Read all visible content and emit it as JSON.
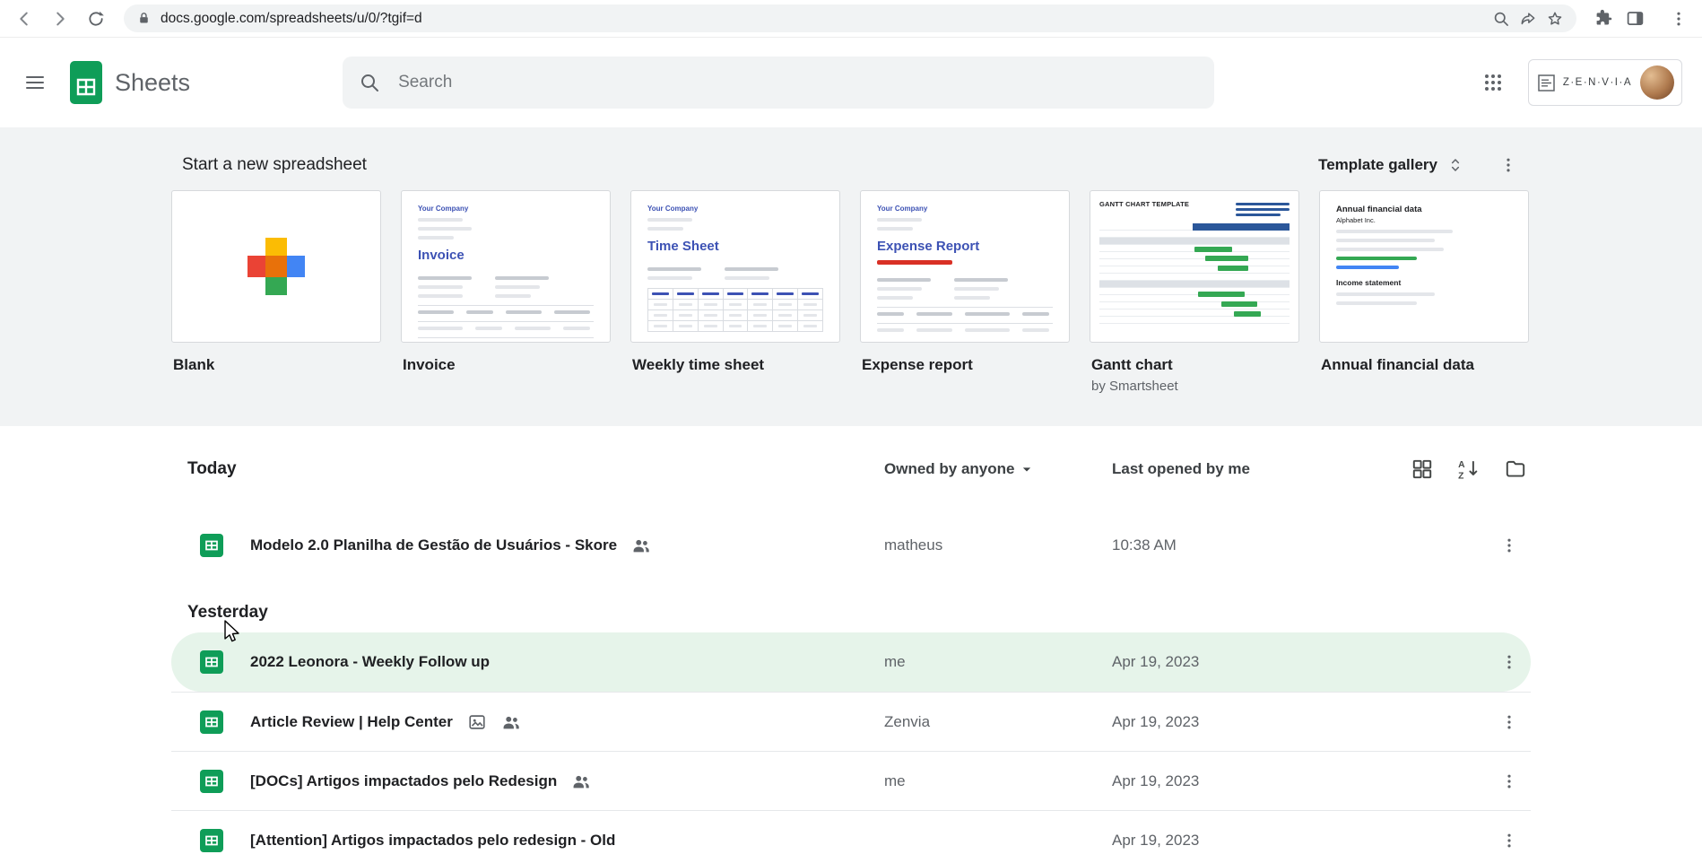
{
  "browser": {
    "url": "docs.google.com/spreadsheets/u/0/?tgif=d"
  },
  "header": {
    "app_name": "Sheets",
    "search_placeholder": "Search",
    "account_label": "Z·E·N·V·I·A"
  },
  "templates": {
    "title": "Start a new spreadsheet",
    "gallery_button": "Template gallery",
    "cards": [
      {
        "label": "Blank"
      },
      {
        "label": "Invoice",
        "thumb": {
          "company": "Your Company",
          "title": "Invoice"
        }
      },
      {
        "label": "Weekly time sheet",
        "thumb": {
          "company": "Your Company",
          "title": "Time Sheet"
        }
      },
      {
        "label": "Expense report",
        "thumb": {
          "company": "Your Company",
          "title": "Expense Report"
        }
      },
      {
        "label": "Gantt chart",
        "sublabel": "by Smartsheet",
        "thumb": {
          "title": "GANTT CHART TEMPLATE"
        }
      },
      {
        "label": "Annual financial data",
        "thumb": {
          "title": "Annual financial data",
          "subtitle": "Alphabet Inc.",
          "section": "Income statement"
        }
      }
    ]
  },
  "list": {
    "owner_filter": "Owned by anyone",
    "last_opened": "Last opened by me",
    "groups": [
      {
        "heading": "Today",
        "rows": [
          {
            "title": "Modelo 2.0 Planilha de Gestão de Usuários - Skore",
            "owner": "matheus",
            "opened": "10:38 AM"
          }
        ]
      },
      {
        "heading": "Yesterday",
        "rows": [
          {
            "title": "2022 Leonora - Weekly Follow up",
            "owner": "me",
            "opened": "Apr 19, 2023"
          },
          {
            "title": "Article Review | Help Center",
            "owner": "Zenvia",
            "opened": "Apr 19, 2023"
          },
          {
            "title": "[DOCs] Artigos impactados pelo Redesign",
            "owner": "me",
            "opened": "Apr 19, 2023"
          },
          {
            "title": "[Attention] Artigos impactados pelo redesign - Old",
            "owner": "",
            "opened": "Apr 19, 2023"
          }
        ]
      }
    ]
  },
  "colors": {
    "sheets_green": "#0f9d58",
    "highlight_green": "#e6f4ea"
  }
}
